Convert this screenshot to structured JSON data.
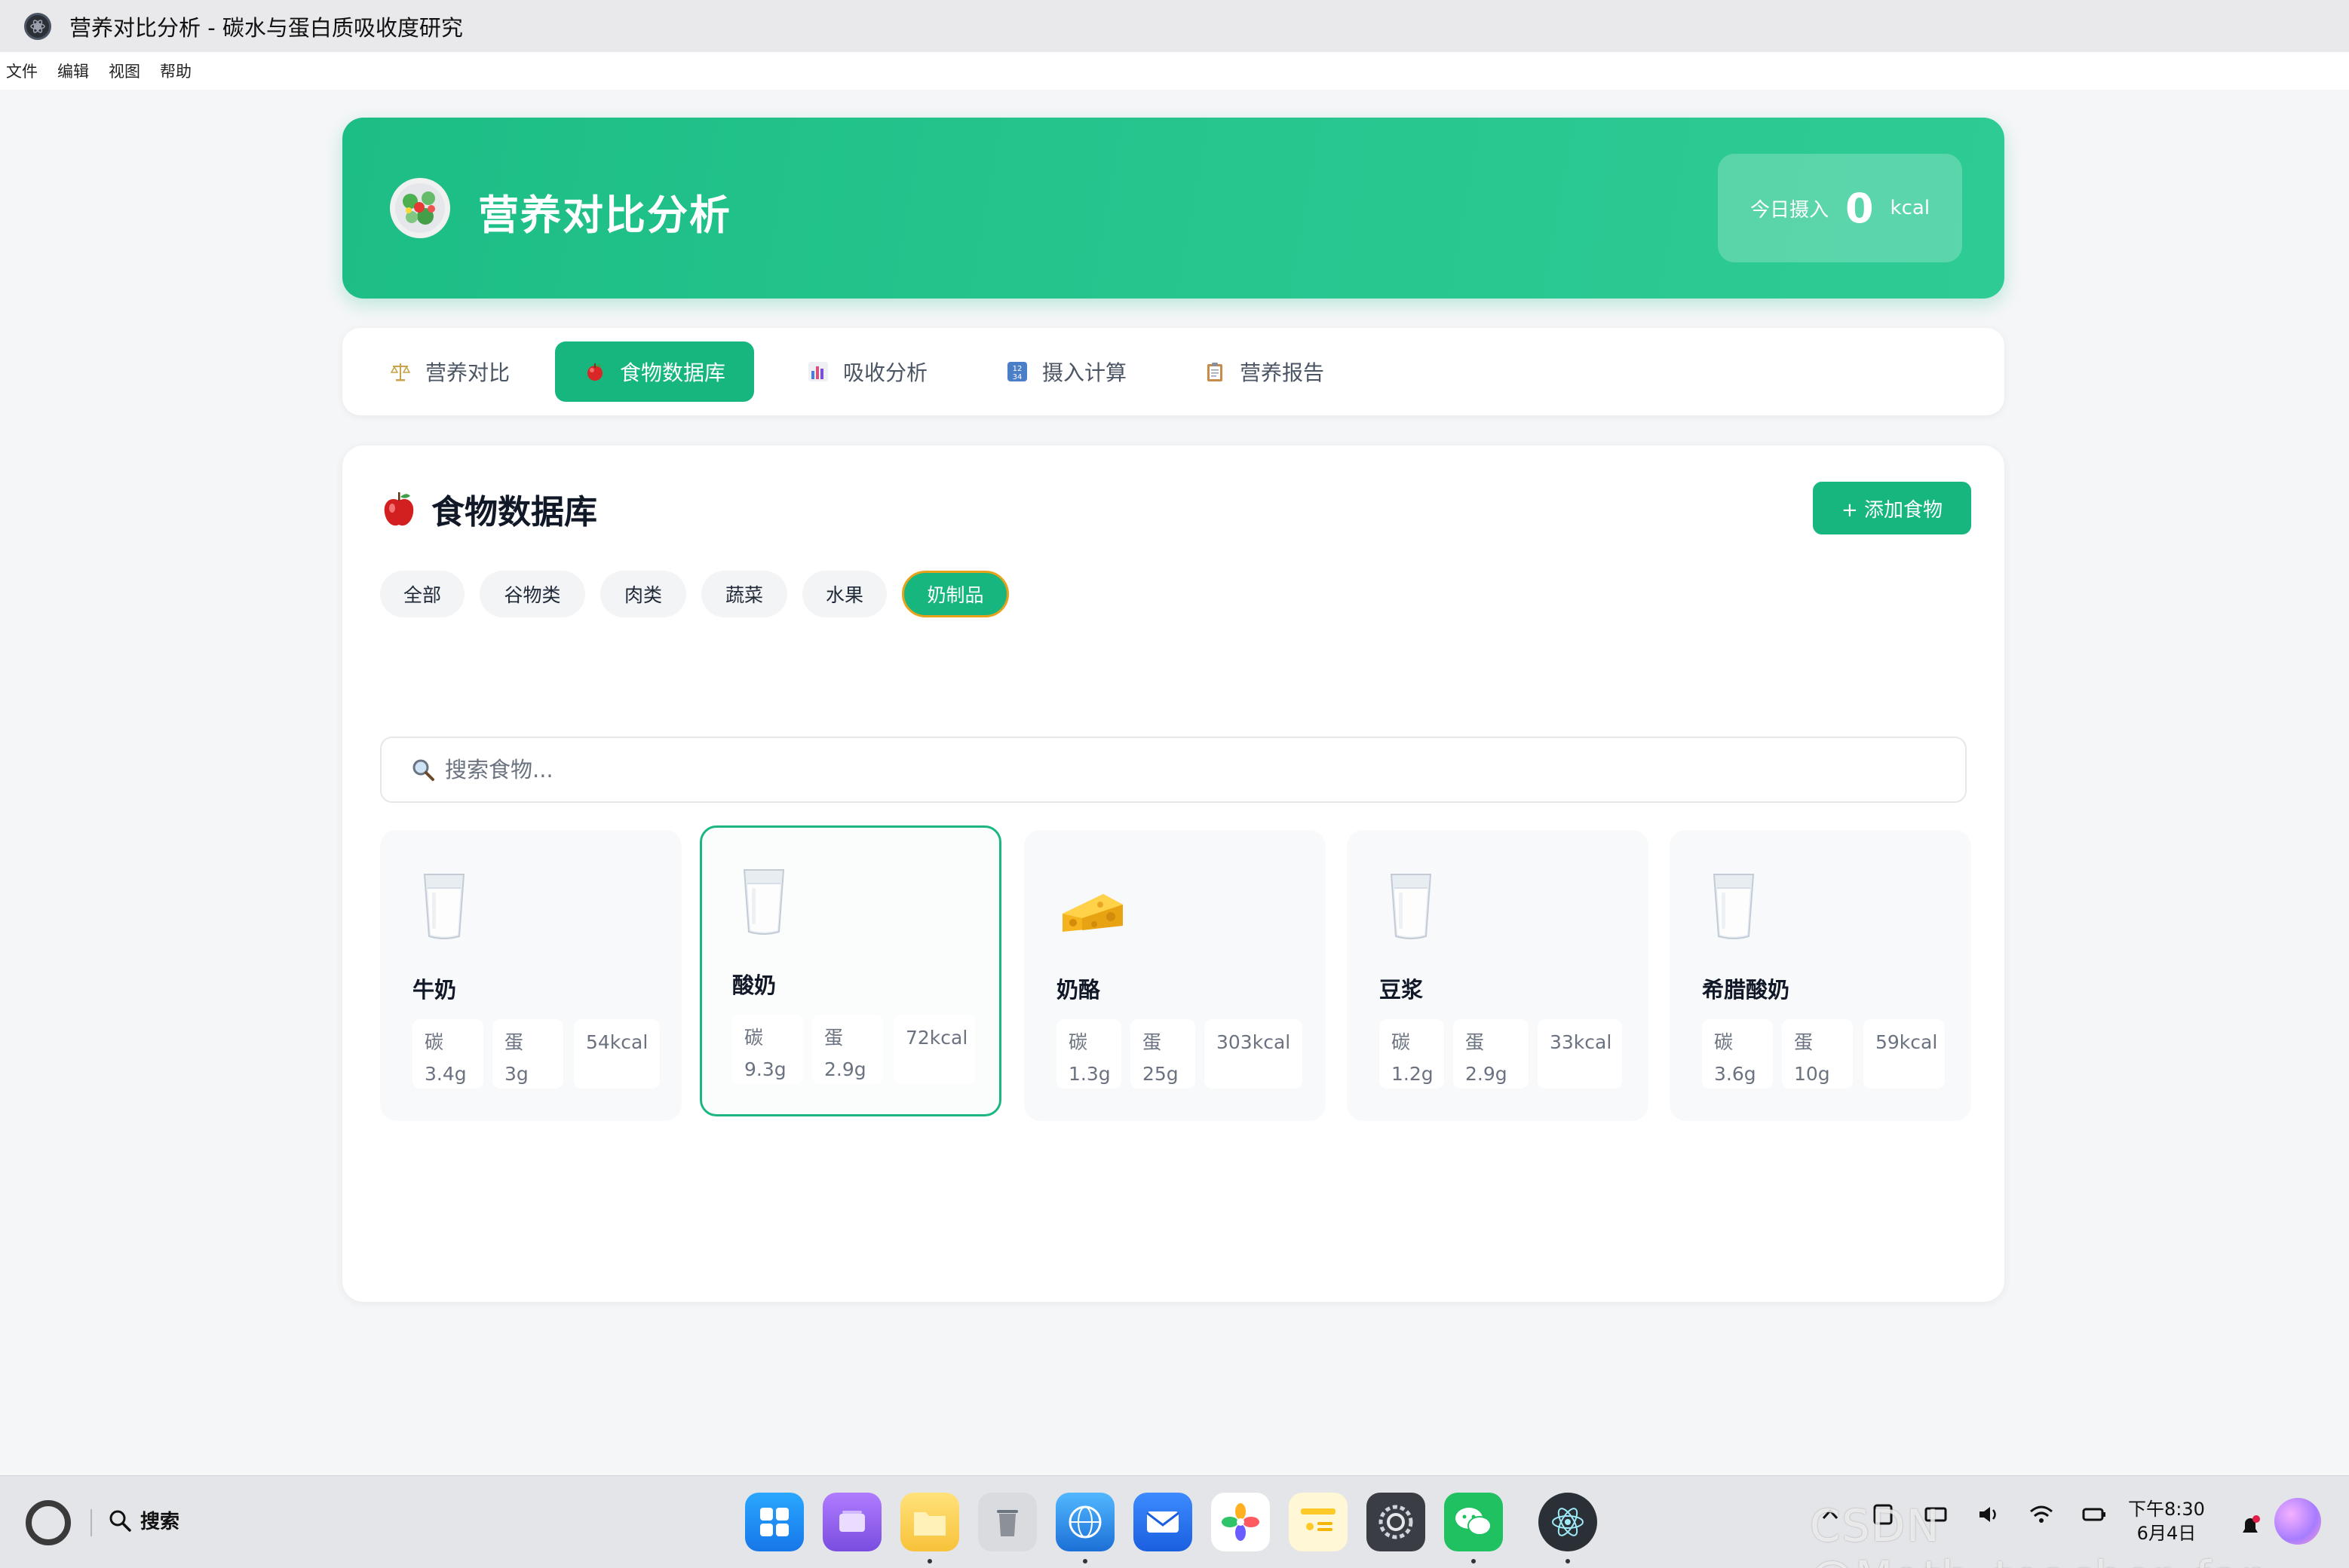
{
  "window": {
    "title": "营养对比分析 - 碳水与蛋白质吸收度研究",
    "menu": [
      "文件",
      "编辑",
      "视图",
      "帮助"
    ]
  },
  "header": {
    "title": "营养对比分析",
    "intake_label": "今日摄入",
    "intake_value": "0",
    "intake_unit": "kcal",
    "logo_icon": "salad-icon"
  },
  "tabs": [
    {
      "label": "营养对比",
      "icon": "balance-scale-icon",
      "active": false
    },
    {
      "label": "食物数据库",
      "icon": "apple-icon",
      "active": true
    },
    {
      "label": "吸收分析",
      "icon": "bar-chart-icon",
      "active": false
    },
    {
      "label": "摄入计算",
      "icon": "number-pad-icon",
      "active": false
    },
    {
      "label": "营养报告",
      "icon": "clipboard-icon",
      "active": false
    }
  ],
  "database": {
    "title": "食物数据库",
    "add_button": "+ 添加食物",
    "filters": [
      "全部",
      "谷物类",
      "肉类",
      "蔬菜",
      "水果",
      "奶制品"
    ],
    "active_filter": "奶制品",
    "search_placeholder": "搜索食物...",
    "foods": [
      {
        "name": "牛奶",
        "icon": "milk-glass-icon",
        "carb_label": "碳",
        "carb": "3.4g",
        "protein_label": "蛋",
        "protein": "3g",
        "kcal": "54kcal",
        "selected": false
      },
      {
        "name": "酸奶",
        "icon": "milk-glass-icon",
        "carb_label": "碳",
        "carb": "9.3g",
        "protein_label": "蛋",
        "protein": "2.9g",
        "kcal": "72kcal",
        "selected": true
      },
      {
        "name": "奶酪",
        "icon": "cheese-icon",
        "carb_label": "碳",
        "carb": "1.3g",
        "protein_label": "蛋",
        "protein": "25g",
        "kcal": "303kcal",
        "selected": false
      },
      {
        "name": "豆浆",
        "icon": "milk-glass-icon",
        "carb_label": "碳",
        "carb": "1.2g",
        "protein_label": "蛋",
        "protein": "2.9g",
        "kcal": "33kcal",
        "selected": false
      },
      {
        "name": "希腊酸奶",
        "icon": "milk-glass-icon",
        "carb_label": "碳",
        "carb": "3.6g",
        "protein_label": "蛋",
        "protein": "10g",
        "kcal": "59kcal",
        "selected": false
      }
    ]
  },
  "taskbar": {
    "search_label": "搜索",
    "apps": [
      "launcher-icon",
      "window-manager-icon",
      "files-icon",
      "trash-icon",
      "browser-icon",
      "mail-icon",
      "photos-icon",
      "notes-icon",
      "settings-icon",
      "wechat-icon",
      "electron-app-icon"
    ],
    "clock_time": "下午8:30",
    "clock_date": "6月4日",
    "watermark": "CSDN @Math_teacher_fan"
  },
  "colors": {
    "accent": "#17b67f",
    "header_gradient_start": "#1dbd86",
    "header_gradient_end": "#2fcb95",
    "active_filter_border": "#e5a21a"
  }
}
